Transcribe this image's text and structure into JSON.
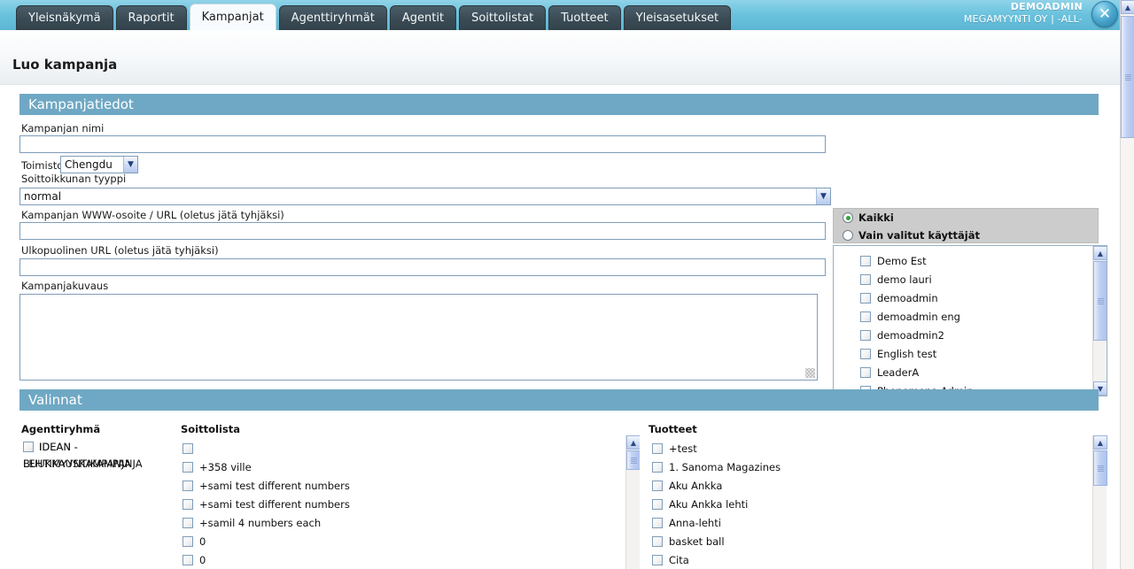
{
  "header": {
    "tabs": [
      {
        "label": "Yleisnäkymä",
        "active": false
      },
      {
        "label": "Raportit",
        "active": false
      },
      {
        "label": "Kampanjat",
        "active": true
      },
      {
        "label": "Agenttiryhmät",
        "active": false
      },
      {
        "label": "Agentit",
        "active": false
      },
      {
        "label": "Soittolistat",
        "active": false
      },
      {
        "label": "Tuotteet",
        "active": false
      },
      {
        "label": "Yleisasetukset",
        "active": false
      }
    ],
    "user_name": "DEMOADMIN",
    "user_org": "MEGAMYYNTI OY | -ALL-",
    "close_label": "✕"
  },
  "page": {
    "title": "Luo kampanja"
  },
  "sections": {
    "campaign_info": "Kampanjatiedot",
    "choices": "Valinnat"
  },
  "form": {
    "name_label": "Kampanjan nimi",
    "name_value": "",
    "office_label": "Toimisto",
    "office_value": "Chengdu",
    "call_window_label": "Soittoikkunan tyyppi",
    "call_window_value": "normal",
    "url_label": "Kampanjan WWW-osoite / URL (oletus jätä tyhjäksi)",
    "url_value": "",
    "external_url_label": "Ulkopuolinen URL (oletus jätä tyhjäksi)",
    "external_url_value": "",
    "description_label": "Kampanjakuvaus",
    "description_value": ""
  },
  "users": {
    "radio_all": "Kaikki",
    "radio_selected": "Vain valitut käyttäjät",
    "selected_radio": "all",
    "items": [
      {
        "label": "Demo Est",
        "checked": false
      },
      {
        "label": "demo lauri",
        "checked": false
      },
      {
        "label": "demoadmin",
        "checked": false
      },
      {
        "label": "demoadmin eng",
        "checked": false
      },
      {
        "label": "demoadmin2",
        "checked": false
      },
      {
        "label": "English test",
        "checked": false
      },
      {
        "label": "LeaderA",
        "checked": false
      },
      {
        "label": "Phenomena Admin",
        "checked": false
      }
    ]
  },
  "choices": {
    "agent_group_header": "Agenttiryhmä",
    "agent_groups": [
      {
        "label": "IDEAN - BUUKKAUSKAMPANJA",
        "checked": false
      },
      {
        "label": "IDEAN - LEHTIMYYNTIKAMPANJA",
        "checked": false
      }
    ],
    "call_list_header": "Soittolista",
    "call_lists": [
      {
        "label": "",
        "checked": false
      },
      {
        "label": "+358 ville",
        "checked": false
      },
      {
        "label": "+sami test different numbers",
        "checked": false
      },
      {
        "label": "+sami test different numbers",
        "checked": false
      },
      {
        "label": "+samil 4 numbers each",
        "checked": false
      },
      {
        "label": "0",
        "checked": false
      },
      {
        "label": "0",
        "checked": false
      }
    ],
    "products_header": "Tuotteet",
    "products": [
      {
        "label": "+test",
        "checked": false
      },
      {
        "label": "1. Sanoma Magazines",
        "checked": false
      },
      {
        "label": "Aku Ankka",
        "checked": false
      },
      {
        "label": "Aku Ankka lehti",
        "checked": false
      },
      {
        "label": "Anna-lehti",
        "checked": false
      },
      {
        "label": "basket ball",
        "checked": false
      },
      {
        "label": "Cita",
        "checked": false
      }
    ]
  },
  "icons": {
    "chevron_down": "▼",
    "scroll_up": "▲",
    "scroll_down": "▼"
  },
  "colors": {
    "header_blue": "#5bb6d4",
    "section_blue": "#6fa8c4",
    "tab_dark": "#3b4b55",
    "radio_green": "#2fa33a"
  }
}
